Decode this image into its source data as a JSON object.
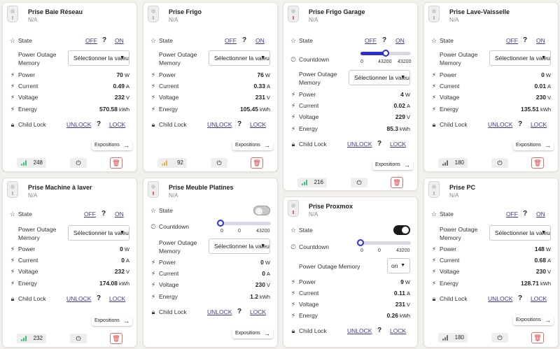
{
  "labels": {
    "state": "State",
    "off": "OFF",
    "on": "ON",
    "help": "?",
    "power_outage_memory": "Power Outage Memory",
    "power": "Power",
    "current": "Current",
    "voltage": "Voltage",
    "energy": "Energy",
    "child_lock": "Child Lock",
    "unlock": "UNLOCK",
    "lock": "LOCK",
    "countdown": "Countdown",
    "expositions": "Expositions"
  },
  "colors": {
    "accent": "#2c2fd1",
    "link": "#3d3a9a",
    "signal_green": "#3bbf7a",
    "signal_amber": "#e8b339",
    "signal_grey": "#6b6b6b",
    "danger": "#e26b6b"
  },
  "icons": {
    "header": "smart-plug-icon",
    "state": "star-icon",
    "countdown": "clock-icon",
    "power": "lightning-icon",
    "child_lock": "padlock-icon",
    "expositions": "arrow-right-icon",
    "signal": "signal-bars-icon",
    "plug_button": "plug-icon",
    "delete": "trash-icon"
  },
  "devices": [
    {
      "name": "Prise Baie Réseau",
      "subtitle": "N/A",
      "power_outage_memory": "Sélectionner la valeur",
      "power": {
        "value": "70",
        "unit": "W"
      },
      "current": {
        "value": "0.49",
        "unit": "A"
      },
      "voltage": {
        "value": "232",
        "unit": "V"
      },
      "energy": {
        "value": "570.58",
        "unit": "kWh"
      },
      "linkquality": "248",
      "signal_color": "#3bbf7a"
    },
    {
      "name": "Prise Frigo",
      "subtitle": "N/A",
      "power_outage_memory": "Sélectionner la valeur",
      "power": {
        "value": "76",
        "unit": "W"
      },
      "current": {
        "value": "0.33",
        "unit": "A"
      },
      "voltage": {
        "value": "231",
        "unit": "V"
      },
      "energy": {
        "value": "105.45",
        "unit": "kWh"
      },
      "linkquality": "92",
      "signal_color": "#e8b339"
    },
    {
      "name": "Prise Frigo Garage",
      "subtitle": "N/A",
      "countdown": {
        "min": "0",
        "max": "43200",
        "current": "43200",
        "fraction": 0.5
      },
      "power_outage_memory": "Sélectionner la valeur",
      "power": {
        "value": "4",
        "unit": "W"
      },
      "current": {
        "value": "0.02",
        "unit": "A"
      },
      "voltage": {
        "value": "229",
        "unit": "V"
      },
      "energy": {
        "value": "85.3",
        "unit": "kWh"
      },
      "linkquality": "216",
      "signal_color": "#3bbf7a"
    },
    {
      "name": "Prise Lave-Vaisselle",
      "subtitle": "N/A",
      "power_outage_memory": "Sélectionner la valeur",
      "power": {
        "value": "0",
        "unit": "W"
      },
      "current": {
        "value": "0.01",
        "unit": "A"
      },
      "voltage": {
        "value": "230",
        "unit": "V"
      },
      "energy": {
        "value": "135.51",
        "unit": "kWh"
      },
      "linkquality": "180",
      "signal_color": "#6b6b6b"
    },
    {
      "name": "Prise Machine à laver",
      "subtitle": "N/A",
      "power_outage_memory": "Sélectionner la valeur",
      "power": {
        "value": "0",
        "unit": "W"
      },
      "current": {
        "value": "0",
        "unit": "A"
      },
      "voltage": {
        "value": "232",
        "unit": "V"
      },
      "energy": {
        "value": "174.08",
        "unit": "kWh"
      },
      "linkquality": "232",
      "signal_color": "#3bbf7a"
    },
    {
      "name": "Prise Meuble Platines",
      "subtitle": "N/A",
      "state_toggle": "off",
      "countdown": {
        "min": "0",
        "max": "43200",
        "current": "0",
        "fraction": 0.0
      },
      "power_outage_memory": "Sélectionner la valeur",
      "power": {
        "value": "0",
        "unit": "W"
      },
      "current": {
        "value": "0",
        "unit": "A"
      },
      "voltage": {
        "value": "230",
        "unit": "V"
      },
      "energy": {
        "value": "1.2",
        "unit": "kWh"
      }
    },
    {
      "name": "Prise Proxmox",
      "subtitle": "N/A",
      "state_toggle": "on",
      "countdown": {
        "min": "0",
        "max": "43200",
        "current": "0",
        "fraction": 0.0
      },
      "power_outage_memory": "on",
      "power": {
        "value": "9",
        "unit": "W"
      },
      "current": {
        "value": "0.11",
        "unit": "A"
      },
      "voltage": {
        "value": "231",
        "unit": "V"
      },
      "energy": {
        "value": "0.26",
        "unit": "kWh"
      }
    },
    {
      "name": "Prise PC",
      "subtitle": "N/A",
      "power_outage_memory": "Sélectionner la valeur",
      "power": {
        "value": "148",
        "unit": "W"
      },
      "current": {
        "value": "0.68",
        "unit": "A"
      },
      "voltage": {
        "value": "230",
        "unit": "V"
      },
      "energy": {
        "value": "128.71",
        "unit": "kWh"
      },
      "linkquality": "180",
      "signal_color": "#6b6b6b"
    }
  ]
}
